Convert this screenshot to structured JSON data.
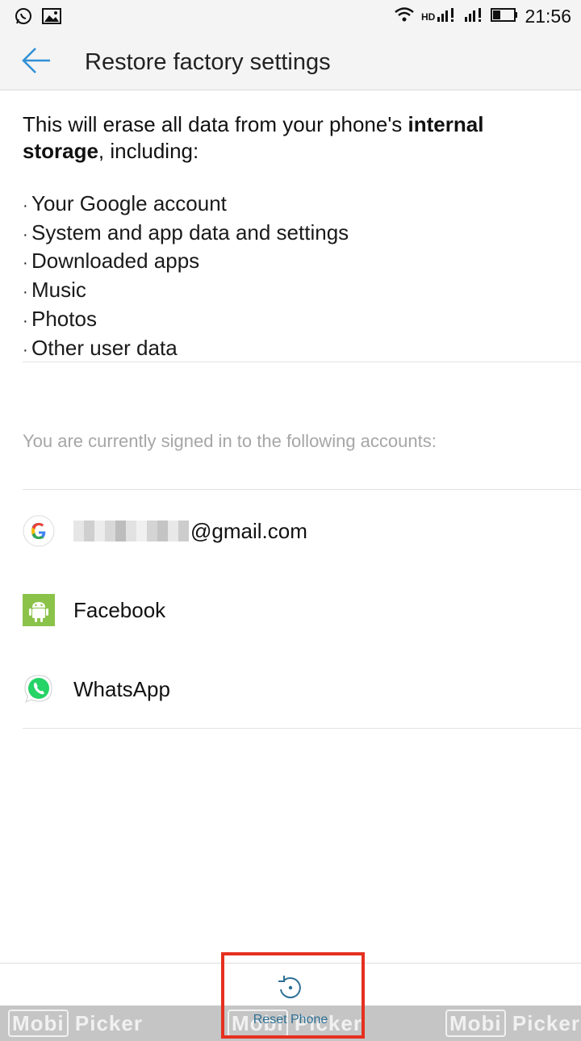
{
  "status_bar": {
    "time": "21:56",
    "left_icons": [
      "whatsapp-icon",
      "image-icon"
    ],
    "right_icons": [
      "wifi-icon",
      "hd-icon",
      "signal-icon",
      "signal-icon",
      "battery-icon"
    ]
  },
  "header": {
    "title": "Restore factory settings",
    "back_icon": "arrow-left-icon"
  },
  "intro": {
    "prefix": "This will erase all data from your phone's ",
    "bold": "internal storage",
    "suffix": ", including:"
  },
  "erase_items": [
    "Your Google account",
    "System and app data and settings",
    "Downloaded apps",
    "Music",
    "Photos",
    "Other user data"
  ],
  "accounts": {
    "heading": "You are currently signed in to the following accounts:",
    "items": [
      {
        "label": "@gmail.com",
        "icon": "google-icon",
        "redacted": true
      },
      {
        "label": "Facebook",
        "icon": "android-icon"
      },
      {
        "label": "WhatsApp",
        "icon": "whatsapp-icon"
      }
    ]
  },
  "footer": {
    "reset_label": "Reset Phone",
    "reset_icon": "reset-icon"
  },
  "watermark": {
    "brand_a": "Mobi",
    "brand_b": "Picker"
  },
  "colors": {
    "accent": "#2f8fd6",
    "highlight": "#e53020",
    "google_blue": "#4285f4",
    "android_green": "#8bc34a",
    "whatsapp_green": "#25d366"
  }
}
